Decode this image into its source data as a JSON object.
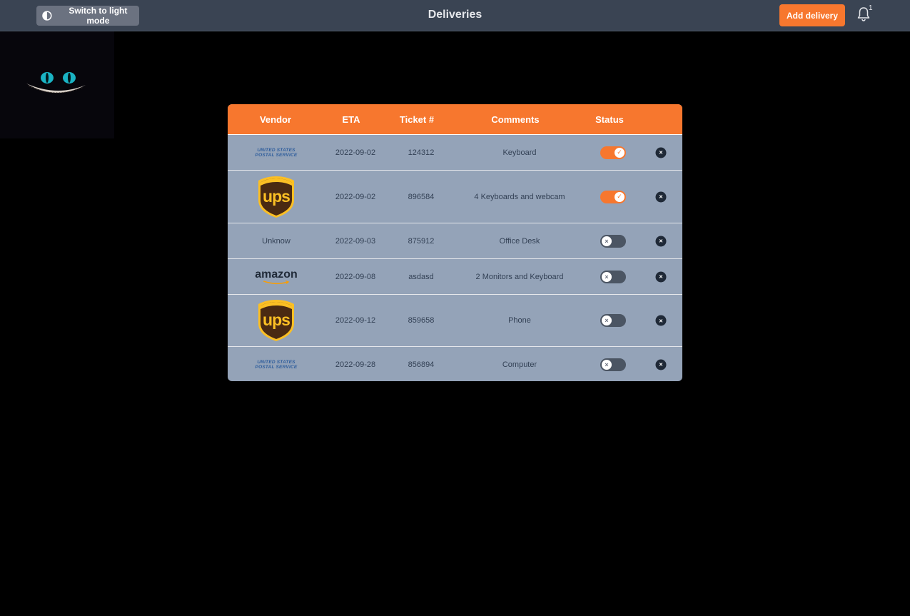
{
  "header": {
    "theme_button_label": "Switch to light mode",
    "title": "Deliveries",
    "add_button_label": "Add delivery",
    "notification_count": "1"
  },
  "colors": {
    "accent": "#f7772e",
    "topbar": "#3a4453",
    "table_body": "#94a3b8"
  },
  "table": {
    "columns": [
      "Vendor",
      "ETA",
      "Ticket #",
      "Comments",
      "Status"
    ],
    "rows": [
      {
        "vendor": "usps",
        "vendor_text": [
          "UNITED STATES",
          "POSTAL SERVICE"
        ],
        "eta": "2022-09-02",
        "ticket": "124312",
        "comment": "Keyboard",
        "status": true
      },
      {
        "vendor": "ups",
        "vendor_text": [
          "ups"
        ],
        "eta": "2022-09-02",
        "ticket": "896584",
        "comment": "4 Keyboards and webcam",
        "status": true
      },
      {
        "vendor": "unknown",
        "vendor_text": [
          "Unknow"
        ],
        "eta": "2022-09-03",
        "ticket": "875912",
        "comment": "Office Desk",
        "status": false
      },
      {
        "vendor": "amazon",
        "vendor_text": [
          "amazon"
        ],
        "eta": "2022-09-08",
        "ticket": "asdasd",
        "comment": "2 Monitors and Keyboard",
        "status": false
      },
      {
        "vendor": "ups",
        "vendor_text": [
          "ups"
        ],
        "eta": "2022-09-12",
        "ticket": "859658",
        "comment": "Phone",
        "status": false
      },
      {
        "vendor": "usps",
        "vendor_text": [
          "UNITED STATES",
          "POSTAL SERVICE"
        ],
        "eta": "2022-09-28",
        "ticket": "856894",
        "comment": "Computer",
        "status": false
      }
    ]
  }
}
